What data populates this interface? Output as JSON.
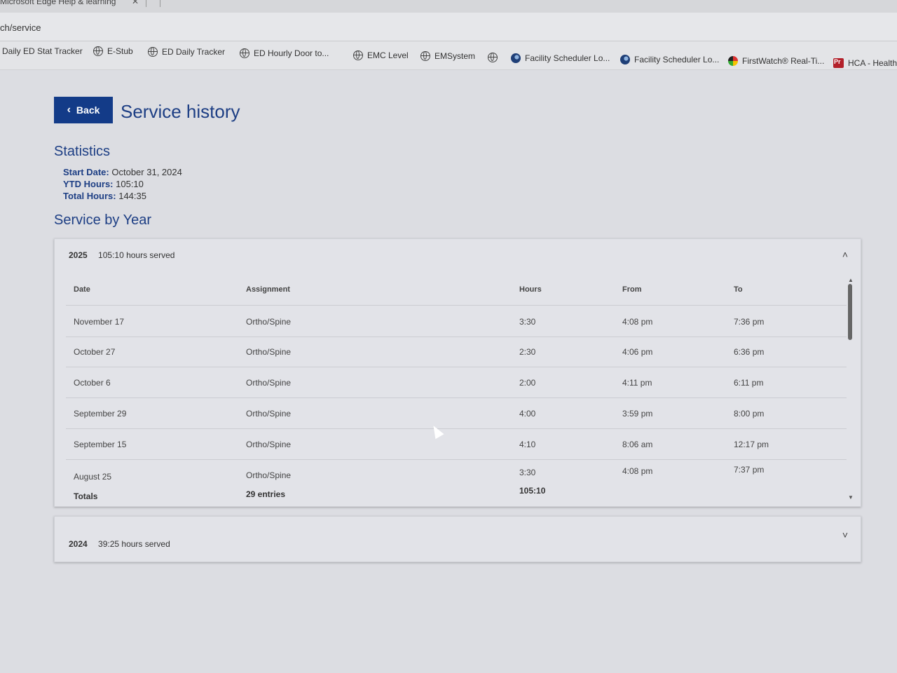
{
  "browser": {
    "tab_title": "Microsoft Edge Help & learning",
    "tab_close": "✕",
    "url": "ch/service",
    "favorites": [
      {
        "label": "Daily ED Stat Tracker",
        "icon": "none"
      },
      {
        "label": "E-Stub",
        "icon": "globe-icon"
      },
      {
        "label": "ED Daily Tracker",
        "icon": "globe-icon"
      },
      {
        "label": "ED Hourly Door to...",
        "icon": "globe-icon"
      },
      {
        "label": "EMC Level",
        "icon": "globe-icon"
      },
      {
        "label": "EMSystem",
        "icon": "globe-icon"
      },
      {
        "label": "",
        "icon": "globe-icon"
      },
      {
        "label": "Facility Scheduler Lo...",
        "icon": "edge-icon"
      },
      {
        "label": "Facility Scheduler Lo...",
        "icon": "edge-icon"
      },
      {
        "label": "FirstWatch® Real-Ti...",
        "icon": "firstwatch-icon"
      },
      {
        "label": "HCA - HealthS",
        "icon": "premiere-icon"
      }
    ]
  },
  "page": {
    "back_label": "Back",
    "title": "Service history",
    "statistics_heading": "Statistics",
    "stats": {
      "start_label": "Start Date:",
      "start_value": "October 31, 2024",
      "ytd_label": "YTD Hours:",
      "ytd_value": "105:10",
      "total_label": "Total Hours:",
      "total_value": "144:35"
    },
    "service_by_year_heading": "Service by Year"
  },
  "years": [
    {
      "year": "2025",
      "summary": "105:10 hours served",
      "expanded": true,
      "columns": [
        "Date",
        "Assignment",
        "Hours",
        "From",
        "To"
      ],
      "rows": [
        {
          "date": "November 17",
          "assignment": "Ortho/Spine",
          "hours": "3:30",
          "from": "4:08 pm",
          "to": "7:36 pm"
        },
        {
          "date": "October 27",
          "assignment": "Ortho/Spine",
          "hours": "2:30",
          "from": "4:06 pm",
          "to": "6:36 pm"
        },
        {
          "date": "October 6",
          "assignment": "Ortho/Spine",
          "hours": "2:00",
          "from": "4:11 pm",
          "to": "6:11 pm"
        },
        {
          "date": "September 29",
          "assignment": "Ortho/Spine",
          "hours": "4:00",
          "from": "3:59 pm",
          "to": "8:00 pm"
        },
        {
          "date": "September 15",
          "assignment": "Ortho/Spine",
          "hours": "4:10",
          "from": "8:06 am",
          "to": "12:17 pm"
        },
        {
          "date": "August 25",
          "assignment": "Ortho/Spine",
          "hours": "3:30",
          "from": "4:08 pm",
          "to": "7:37 pm"
        }
      ],
      "totals": {
        "label": "Totals",
        "entries": "29 entries",
        "hours": "105:10"
      }
    },
    {
      "year": "2024",
      "summary": "39:25 hours served",
      "expanded": false
    }
  ],
  "icons": {
    "expand_less": "˄",
    "expand_more": "˅",
    "back_chevron": "‹"
  },
  "colors": {
    "primary": "#133b88",
    "heading": "#1d3e84",
    "background": "#dcdde2"
  }
}
